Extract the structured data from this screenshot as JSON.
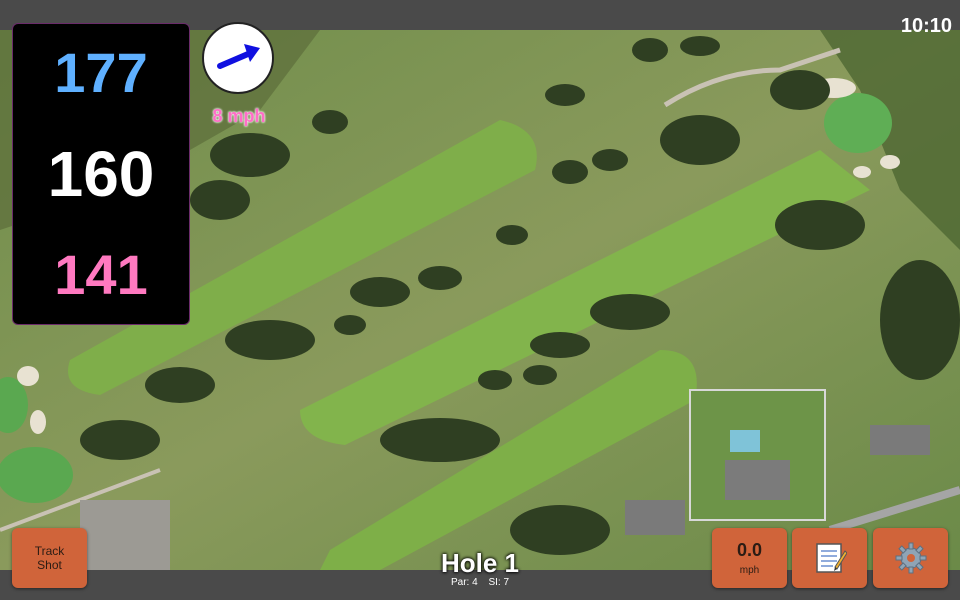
{
  "status": {
    "time": "10:10"
  },
  "distances": {
    "back": "177",
    "center": "160",
    "front": "141"
  },
  "wind": {
    "speed": "8 mph",
    "icon": "wind-arrow-icon"
  },
  "track_shot": {
    "label_line1": "Track",
    "label_line2": "Shot"
  },
  "hole": {
    "title": "Hole 1",
    "par": "Par: 4",
    "stroke_index": "SI: 7"
  },
  "speed": {
    "value": "0.0",
    "unit": "mph"
  },
  "icons": {
    "notes": "notepad-icon",
    "settings": "gear-icon"
  },
  "colors": {
    "back_distance": "#5fb0ff",
    "center_distance": "#ffffff",
    "front_distance": "#ff79c0",
    "wind_speed": "#ff6ec7",
    "button": "#d0643a"
  }
}
